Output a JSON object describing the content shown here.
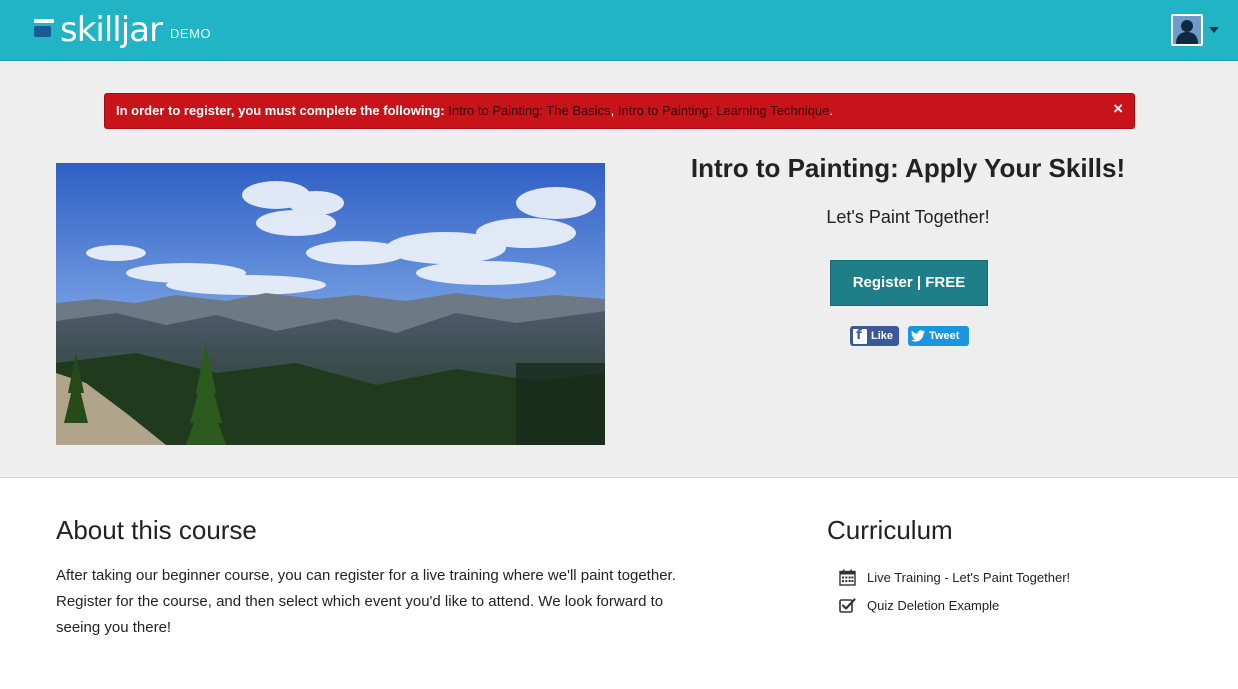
{
  "header": {
    "logo_text": "skilljar",
    "logo_suffix": "DEMO",
    "brand_color": "#21b4c4"
  },
  "alert": {
    "message": "In order to register, you must complete the following: ",
    "prerequisites": [
      "Intro to Painting: The Basics",
      "Intro to Painting: Learning Technique"
    ],
    "separator": ", ",
    "trailing": ".",
    "close_label": "×",
    "color": "#c9131a"
  },
  "course": {
    "title": "Intro to Painting: Apply Your Skills!",
    "subtitle": "Let's Paint Together!",
    "register_label": "Register | FREE",
    "share": {
      "facebook_label": "Like",
      "twitter_label": "Tweet"
    }
  },
  "about": {
    "heading": "About this course",
    "text": "After taking our beginner course, you can register for a live training where we'll paint together. Register for the course, and then select which event you'd like to attend. We look forward to seeing you there!"
  },
  "curriculum": {
    "heading": "Curriculum",
    "items": [
      {
        "label": "Live Training - Let's Paint Together!",
        "icon": "calendar-icon"
      },
      {
        "label": "Quiz Deletion Example",
        "icon": "checkbox-icon"
      }
    ]
  }
}
